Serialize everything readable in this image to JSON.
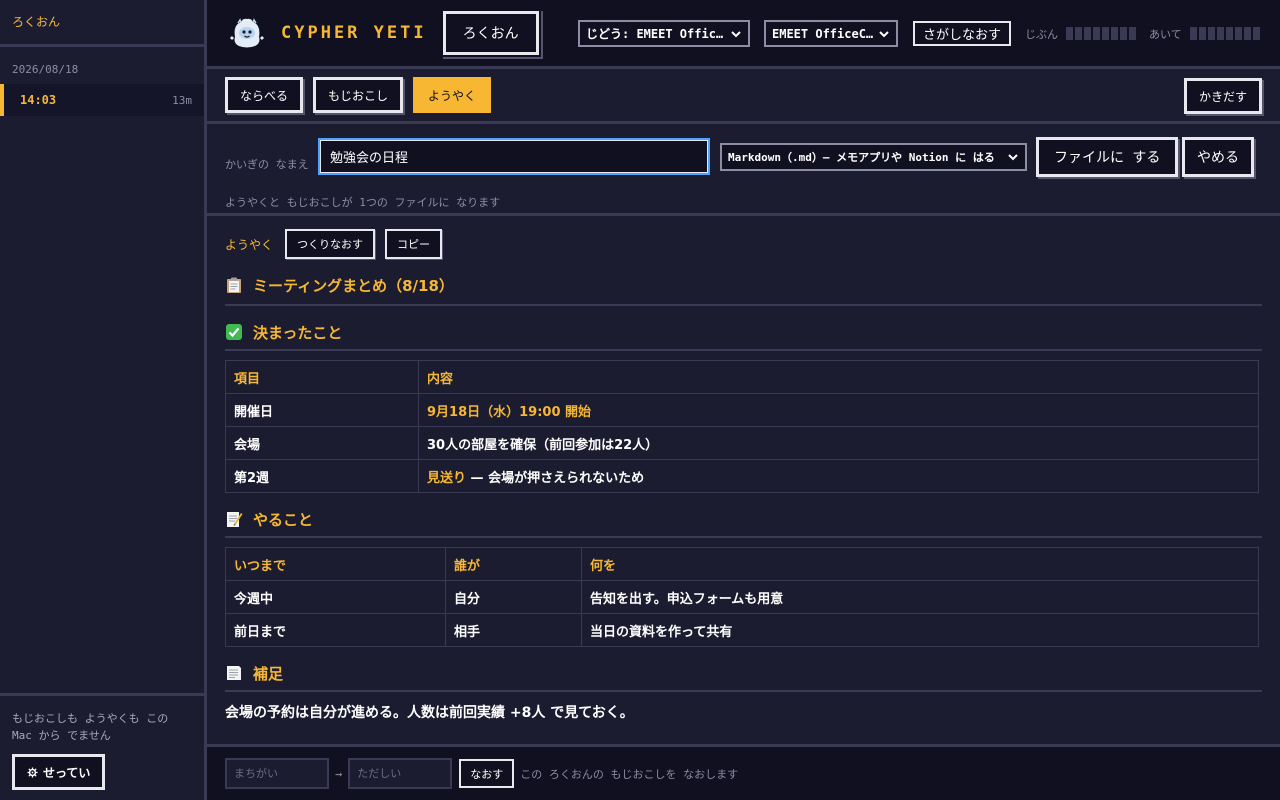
{
  "sidebar": {
    "title": "ろくおん",
    "date": "2026/08/18",
    "recordings": [
      {
        "time": "14:03",
        "duration": "13m"
      }
    ],
    "note": "もじおこしも ようやくも この Mac から でません",
    "settings_label": "せってい",
    "settings_icon": "gear-icon"
  },
  "header": {
    "brand": "CYPHER YETI",
    "record_label": "ろくおん",
    "auto_select": "じどう: EMEET Office…",
    "mic_select": "EMEET OfficeCo…",
    "rescan_label": "さがしなおす",
    "self_label": "じぶん",
    "other_label": "あいて",
    "self_level": 0,
    "other_level": 0
  },
  "tabs": {
    "items": [
      "ならべる",
      "もじおこし",
      "ようやく"
    ],
    "active": "ようやく",
    "export_label": "かきだす"
  },
  "save": {
    "name_label": "かいぎの なまえ",
    "name_value": "勉強会の日程",
    "format_value": "Markdown（.md）— メモアプリや Notion に はる",
    "save_label": "ファイルに する",
    "cancel_label": "やめる",
    "note": "ようやくと もじおこしが 1つの ファイルに なります"
  },
  "summary": {
    "label": "ようやく",
    "regen_label": "つくりなおす",
    "copy_label": "コピー",
    "title": "ミーティングまとめ（8/18）",
    "decided": {
      "heading": "決まったこと",
      "headers": [
        "項目",
        "内容"
      ],
      "rows": [
        {
          "item": "開催日",
          "content": "9月18日（水）19:00 開始"
        },
        {
          "item": "会場",
          "content": "30人の部屋を確保（前回参加は22人）"
        },
        {
          "item": "第2週",
          "content_hl": "見送り",
          "content_rest": " — 会場が押さえられないため"
        }
      ]
    },
    "todo": {
      "heading": "やること",
      "headers": [
        "いつまで",
        "誰が",
        "何を"
      ],
      "rows": [
        {
          "when": "今週中",
          "who": "自分",
          "what": "告知を出す。申込フォームも用意"
        },
        {
          "when": "前日まで",
          "who": "相手",
          "what": "当日の資料を作って共有"
        }
      ]
    },
    "notes": {
      "heading": "補足",
      "text": "会場の予約は自分が進める。人数は前回実績 +8人 で見ておく。"
    }
  },
  "fix": {
    "wrong_placeholder": "まちがい",
    "arrow": "→",
    "right_placeholder": "ただしい",
    "button_label": "なおす",
    "note": "この ろくおんの もじおこしを なおします"
  },
  "colors": {
    "accent": "#f7b733",
    "background": "#1c1c30",
    "panel": "#101020",
    "border": "#3a3a55"
  }
}
